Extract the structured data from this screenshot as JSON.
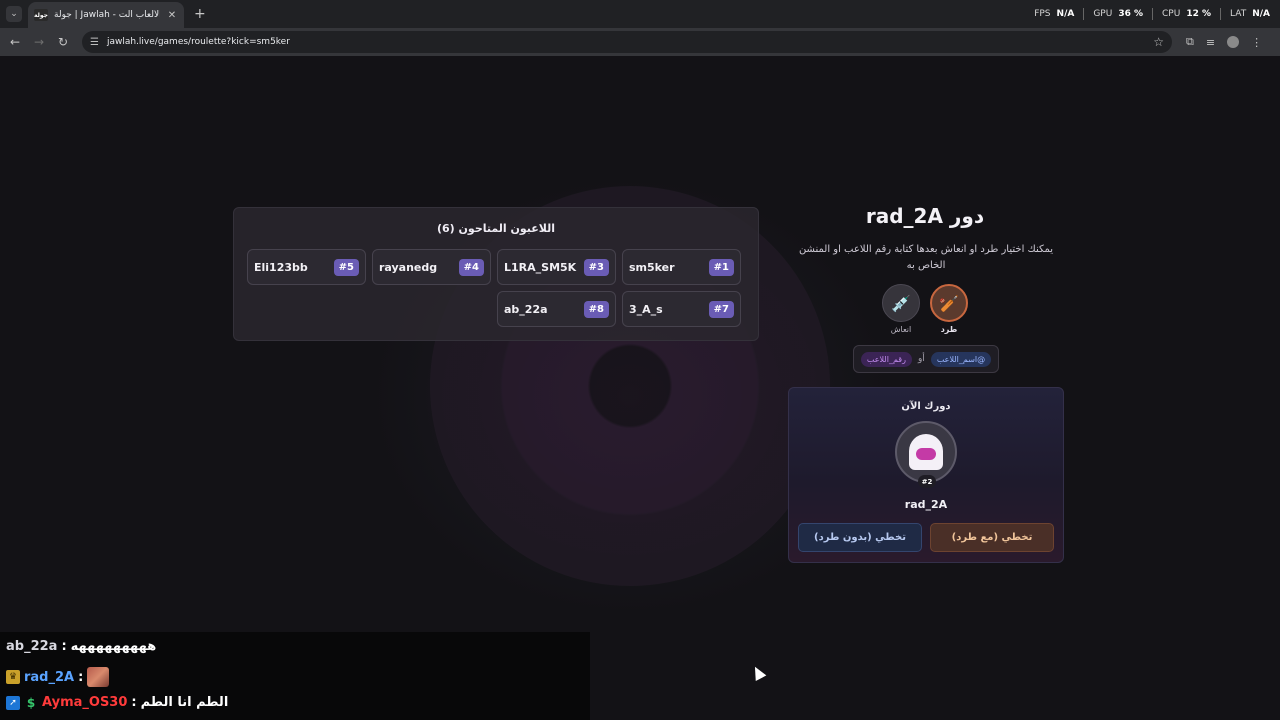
{
  "browser": {
    "tab_favicon_text": "جولة",
    "tab_title": "جولة | Jawlah - منصة الألعاب الت...",
    "url": "jawlah.live/games/roulette?kick=sm5ker",
    "stats": {
      "fps_label": "FPS",
      "fps_value": "N/A",
      "gpu_label": "GPU",
      "gpu_value": "36 %",
      "cpu_label": "CPU",
      "cpu_value": "12 %",
      "lat_label": "LAT",
      "lat_value": "N/A"
    }
  },
  "players_panel": {
    "title": "اللاعبون المتاحون (6)",
    "players": [
      {
        "name": "sm5ker",
        "num": "#1"
      },
      {
        "name": "L1RA_SM5K",
        "num": "#3"
      },
      {
        "name": "rayanedg",
        "num": "#4"
      },
      {
        "name": "Eli123bb",
        "num": "#5"
      },
      {
        "name": "3_A_s",
        "num": "#7"
      },
      {
        "name": "ab_22a",
        "num": "#8"
      }
    ]
  },
  "turn": {
    "title": "دور rad_2A",
    "hint": "يمكنك اختيار طرد او انعاش بعدها كتابة رقم اللاعب او المنشن الخاص به",
    "kick_label": "طرد",
    "revive_label": "انعاش",
    "kick_icon": "bat-icon",
    "revive_icon": "syringe-icon",
    "mention_chip": "@اسم_اللاعب",
    "or_text": "أو",
    "number_chip": "رقم_اللاعب"
  },
  "current": {
    "label": "دورك الآن",
    "player_num": "#2",
    "player_name": "rad_2A",
    "skip_kick": "تخطي (مع طرد)",
    "skip_nokick": "تخطي (بدون طرد)"
  },
  "chat": [
    {
      "user": "ab_22a",
      "sep": " :",
      "msg": "هههههههههه"
    },
    {
      "user": "rad_2A",
      "sep": " :",
      "msg": ""
    },
    {
      "user": "Ayma_OS30",
      "sep": " :",
      "msg": "الطم انا الطم"
    }
  ]
}
